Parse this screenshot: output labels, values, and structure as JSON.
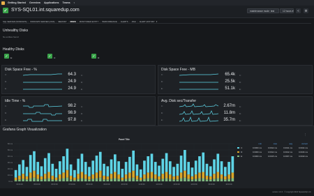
{
  "topnav": {
    "items": [
      "Getting Started",
      "Overview",
      "Applications",
      "Teams"
    ],
    "more": "▾"
  },
  "header": {
    "title": "SYS-SQL01.int.squaredup.com",
    "maintenance_label": "maintenance mode",
    "maintenance_value": "test",
    "time_range": "12 hours",
    "icons": [
      "chevron-down-icon",
      "share-icon",
      "gear-icon"
    ]
  },
  "tabs": [
    "SQL SERVER (WINDOWS)",
    "WINDOWS SERVER (2016)",
    "MEMORY",
    "DISKS",
    "MONITORED ENTITY",
    "PERFORMANCE",
    "ALERTS",
    "JAVA",
    "ALERT HISTORY"
  ],
  "active_tab": "DISKS",
  "unhealthy": {
    "title": "Unhealthy Disks",
    "empty_text": "No entities found"
  },
  "healthy": {
    "title": "Healthy Disks",
    "disks": [
      "E:",
      "C:",
      "D:"
    ]
  },
  "panels": {
    "free_pct": {
      "title": "Disk Space Free - %",
      "rows": [
        {
          "name": "C:",
          "value": "64.3",
          "tag": "C:"
        },
        {
          "name": "D:",
          "value": "24.9",
          "tag": "D:"
        },
        {
          "name": "E:",
          "value": "24.9",
          "tag": "E:"
        }
      ]
    },
    "free_mb": {
      "title": "Disk Space Free - MB",
      "rows": [
        {
          "name": "C:",
          "value": "65.4k",
          "tag": "C:"
        },
        {
          "name": "D:",
          "value": "25.5k",
          "tag": "D:"
        },
        {
          "name": "E:",
          "value": "51.1k",
          "tag": "E:"
        }
      ]
    },
    "idle": {
      "title": "Idle Time - %",
      "rows": [
        {
          "name": "C:",
          "value": "98.2",
          "tag": "C:"
        },
        {
          "name": "D:",
          "value": "98.9",
          "tag": "D:"
        },
        {
          "name": "E:",
          "value": "97.8",
          "tag": "E:"
        }
      ]
    },
    "sec_transfer": {
      "title": "Avg. Disk sec/Transfer",
      "rows": [
        {
          "name": "C:",
          "value": "2.67m",
          "tag": "C:"
        },
        {
          "name": "D:",
          "value": "11.8m",
          "tag": "D:"
        },
        {
          "name": "E:",
          "value": "35.7m",
          "tag": "E:"
        }
      ]
    }
  },
  "graph": {
    "title": "Grafana Graph Visualization",
    "legend_headers": [
      "min",
      "max",
      "avg",
      "current"
    ],
    "legend_rows": [
      {
        "name": "C:",
        "color": "#5ed4e6",
        "values": [
          "0.0000 ms",
          "0.0012 ms",
          "0.0011 ms",
          "0.0014 ms"
        ]
      },
      {
        "name": "D:",
        "color": "#d9a62a",
        "values": [
          "0.0000 ms",
          "0.0012 ms",
          "0.0012 ms",
          "0.0016 ms"
        ]
      },
      {
        "name": "E:",
        "color": "#7fb77e",
        "values": [
          "0.0000 ms",
          "0.0015 ms",
          "0.0037 ms",
          "0.0019 ms"
        ]
      }
    ]
  },
  "chart_data": {
    "type": "bar",
    "title": "Panel Title",
    "ylabel": "",
    "ylim": [
      0,
      0.06
    ],
    "yticks": [
      "60 ms",
      "50 ms",
      "40 ms",
      "30 ms",
      "20 ms",
      "10 ms",
      "0 ms"
    ],
    "xticks": [
      "04:00:00",
      "05:00:00",
      "06:00:00",
      "07:00:00",
      "08:00:00",
      "09:00:00",
      "10:00:00",
      "11:00:00",
      "12:00:00",
      "13:00:00",
      "14:00:00",
      "15:00:00",
      "16:00:00"
    ],
    "series": [
      {
        "name": "C:",
        "color": "#5ed4e6",
        "values": [
          0.012,
          0.018,
          0.022,
          0.015,
          0.028,
          0.031,
          0.02,
          0.016,
          0.025,
          0.03,
          0.019,
          0.014,
          0.021,
          0.026,
          0.034,
          0.018,
          0.012,
          0.024,
          0.029,
          0.02,
          0.015,
          0.022,
          0.027,
          0.03,
          0.019,
          0.016,
          0.023,
          0.028,
          0.021,
          0.014,
          0.02,
          0.025,
          0.032,
          0.018,
          0.013,
          0.022,
          0.026,
          0.029,
          0.02,
          0.017,
          0.024,
          0.03,
          0.021,
          0.015,
          0.019,
          0.027,
          0.033,
          0.02,
          0.014,
          0.022,
          0.026,
          0.031,
          0.019,
          0.016,
          0.023,
          0.029,
          0.021,
          0.015,
          0.02,
          0.026
        ]
      },
      {
        "name": "D:",
        "color": "#d9a62a",
        "values": [
          0.004,
          0.006,
          0.008,
          0.005,
          0.009,
          0.011,
          0.007,
          0.005,
          0.008,
          0.01,
          0.006,
          0.004,
          0.007,
          0.009,
          0.012,
          0.006,
          0.004,
          0.008,
          0.01,
          0.007,
          0.005,
          0.007,
          0.009,
          0.011,
          0.006,
          0.005,
          0.008,
          0.01,
          0.007,
          0.004,
          0.007,
          0.009,
          0.011,
          0.006,
          0.004,
          0.007,
          0.009,
          0.01,
          0.007,
          0.005,
          0.008,
          0.01,
          0.007,
          0.005,
          0.006,
          0.009,
          0.011,
          0.007,
          0.005,
          0.007,
          0.009,
          0.01,
          0.006,
          0.005,
          0.008,
          0.01,
          0.007,
          0.005,
          0.007,
          0.009
        ]
      },
      {
        "name": "E:",
        "color": "#7fb77e",
        "values": [
          0.002,
          0.003,
          0.004,
          0.003,
          0.005,
          0.006,
          0.004,
          0.003,
          0.004,
          0.005,
          0.003,
          0.002,
          0.004,
          0.005,
          0.006,
          0.003,
          0.002,
          0.004,
          0.005,
          0.004,
          0.003,
          0.004,
          0.005,
          0.006,
          0.003,
          0.003,
          0.004,
          0.005,
          0.004,
          0.002,
          0.004,
          0.005,
          0.006,
          0.003,
          0.002,
          0.004,
          0.005,
          0.005,
          0.004,
          0.003,
          0.004,
          0.005,
          0.004,
          0.003,
          0.003,
          0.005,
          0.006,
          0.004,
          0.003,
          0.004,
          0.005,
          0.005,
          0.003,
          0.003,
          0.004,
          0.005,
          0.004,
          0.003,
          0.004,
          0.005
        ]
      }
    ],
    "grid": true,
    "legend": "top-right"
  },
  "footer": "version 1.0.0 · © copyright 2024 SquaredUp Ltd."
}
